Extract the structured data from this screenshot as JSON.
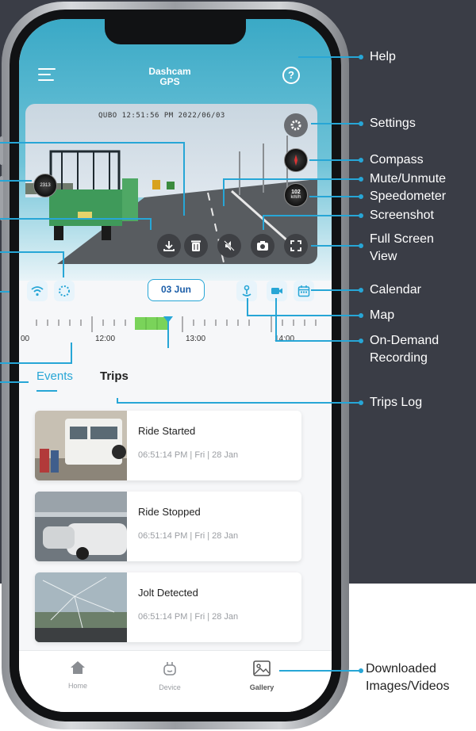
{
  "app": {
    "title_line1": "Dashcam",
    "title_line2": "GPS"
  },
  "header": {
    "help_glyph": "?"
  },
  "video": {
    "timestamp": "QUBO 12:51:56 PM 2022/06/03",
    "speed_value": "102",
    "speed_unit": "km/h",
    "compass_value": "2313"
  },
  "timeline": {
    "date": "03 Jun",
    "labels": [
      "00",
      "12:00",
      "13:00",
      "14:00"
    ]
  },
  "tabs": [
    {
      "label": "Events"
    },
    {
      "label": "Trips"
    }
  ],
  "events": [
    {
      "title": "Ride Started",
      "time": "06:51:14 PM | Fri | 28 Jan"
    },
    {
      "title": "Ride Stopped",
      "time": "06:51:14 PM | Fri | 28 Jan"
    },
    {
      "title": "Jolt Detected",
      "time": "06:51:14 PM | Fri | 28 Jan"
    }
  ],
  "nav": [
    {
      "label": "Home",
      "icon": "home-icon"
    },
    {
      "label": "Device",
      "icon": "device-icon"
    },
    {
      "label": "Gallery",
      "icon": "gallery-icon"
    }
  ],
  "callouts": {
    "help": "Help",
    "settings": "Settings",
    "compass": "Compass",
    "mute": "Mute/Unmute",
    "speedometer": "Speedometer",
    "screenshot": "Screenshot",
    "fullscreen_1": "Full Screen",
    "fullscreen_2": "View",
    "calendar": "Calendar",
    "map": "Map",
    "ondemand_1": "On-Demand",
    "ondemand_2": "Recording",
    "trips_log": "Trips Log",
    "downloaded_1": "Downloaded",
    "downloaded_2": "Images/Videos"
  },
  "colors": {
    "accent": "#27a6d6",
    "background": "#3a3d46",
    "screen_top": "#3aa9c6"
  }
}
